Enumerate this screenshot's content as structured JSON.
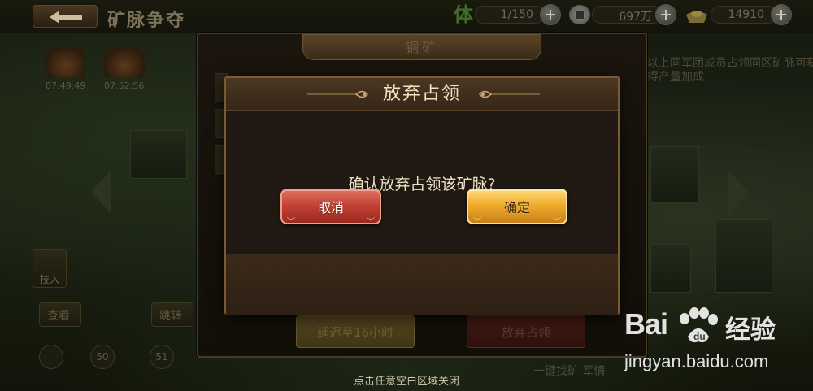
{
  "topbar": {
    "title": "矿脉争夺",
    "stamina": {
      "label": "体",
      "value": "1/150"
    },
    "silver": {
      "value": "697万"
    },
    "gold": {
      "value": "14910"
    }
  },
  "mine_list": {
    "timers": [
      "07:49:49",
      "07:52:56"
    ]
  },
  "side": {
    "left_badge": "技入",
    "left_tab_a": "查看",
    "left_tab_b": "跳转",
    "rounds": [
      "50",
      "51"
    ]
  },
  "right_info": {
    "hint": "以上同军团成员占领同区矿脉可获得产量加成",
    "bottom_text": "一键找矿  军情"
  },
  "mine_panel": {
    "title": "铜矿",
    "delay_button": "延迟至16小时",
    "giveup_button": "放弃占领"
  },
  "dialog": {
    "title": "放弃占领",
    "message": "确认放弃占领该矿脉?",
    "cancel_label": "取消",
    "confirm_label": "确定"
  },
  "close_hint": "点击任意空白区域关闭",
  "watermark": {
    "logo": "Bai",
    "logo_cn": "经验",
    "url": "jingyan.baidu.com"
  },
  "icons": [
    "back-arrow-icon",
    "stamina-icon",
    "silver-coin-icon",
    "gold-ingot-icon",
    "plus-icon",
    "ornament-icon",
    "paw-icon"
  ]
}
